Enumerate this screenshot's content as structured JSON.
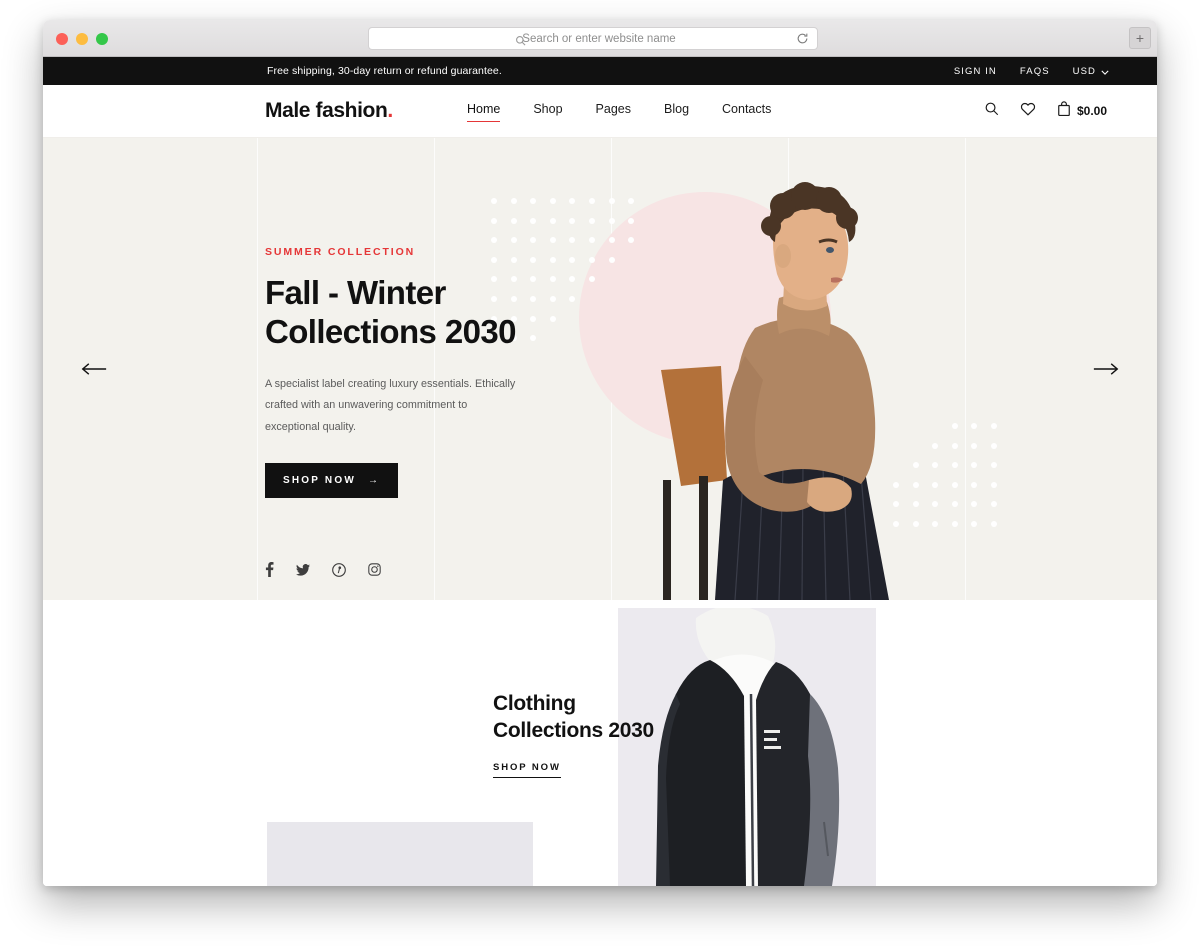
{
  "browser": {
    "search_placeholder": "Search or enter website name",
    "search_icon": "search-icon",
    "reload_icon": "reload-icon",
    "new_tab_label": "+"
  },
  "announcement": {
    "message": "Free shipping, 30-day return or refund guarantee.",
    "links": [
      {
        "label": "SIGN IN"
      },
      {
        "label": "FAQS"
      }
    ],
    "currency": "USD",
    "currency_caret_icon": "chevron-down-icon"
  },
  "header": {
    "logo_text": "Male fashion",
    "logo_dot": ".",
    "nav": [
      {
        "label": "Home",
        "active": true
      },
      {
        "label": "Shop",
        "active": false
      },
      {
        "label": "Pages",
        "active": false
      },
      {
        "label": "Blog",
        "active": false
      },
      {
        "label": "Contacts",
        "active": false
      }
    ],
    "icons": [
      {
        "name": "search-icon"
      },
      {
        "name": "heart-icon"
      },
      {
        "name": "shopping-bag-icon"
      }
    ],
    "cart_total": "$0.00"
  },
  "hero": {
    "eyebrow": "SUMMER COLLECTION",
    "title_line1": "Fall - Winter",
    "title_line2": "Collections 2030",
    "description": "A specialist label creating luxury essentials. Ethically crafted with an unwavering commitment to exceptional quality.",
    "cta_label": "SHOP NOW",
    "cta_arrow": "→",
    "prev_arrow": "←",
    "next_arrow": "→",
    "socials": [
      {
        "name": "facebook-icon"
      },
      {
        "name": "twitter-icon"
      },
      {
        "name": "pinterest-icon"
      },
      {
        "name": "instagram-icon"
      }
    ],
    "colors": {
      "background": "#f3f2ed",
      "accent": "#e53637",
      "circle": "#f7e4e4",
      "dots": "#ffffff"
    }
  },
  "collections": {
    "title_line1": "Clothing",
    "title_line2": "Collections 2030",
    "link_label": "SHOP NOW",
    "card_background": "#eceaef"
  }
}
